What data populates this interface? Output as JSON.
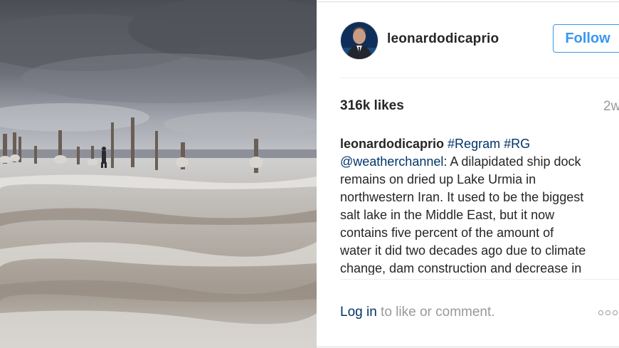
{
  "post": {
    "username": "leonardodicaprio",
    "follow_label": "Follow",
    "likes": "316k likes",
    "age": "2w",
    "caption_lines": [
      {
        "user": "leonardodicaprio",
        "tag1": "#Regram",
        "tag2": "#RG"
      },
      {
        "mention": "@weatherchannel",
        "text": ": A dilapidated ship dock"
      },
      {
        "text": "remains on dried up Lake Urmia in"
      },
      {
        "text": "northwestern Iran. It used to be the biggest"
      },
      {
        "text": "salt lake in the Middle East, but it now"
      },
      {
        "text": "contains five percent of the amount of"
      },
      {
        "text": "water it did two decades ago due to climate"
      },
      {
        "text": "change, dam construction and decrease in"
      }
    ],
    "login_label": "Log in",
    "comment_prompt": " to like or comment.",
    "more_icon": "ellipsis-icon"
  },
  "colors": {
    "link": "#003569",
    "follow": "#3897f0",
    "muted": "#999999"
  }
}
